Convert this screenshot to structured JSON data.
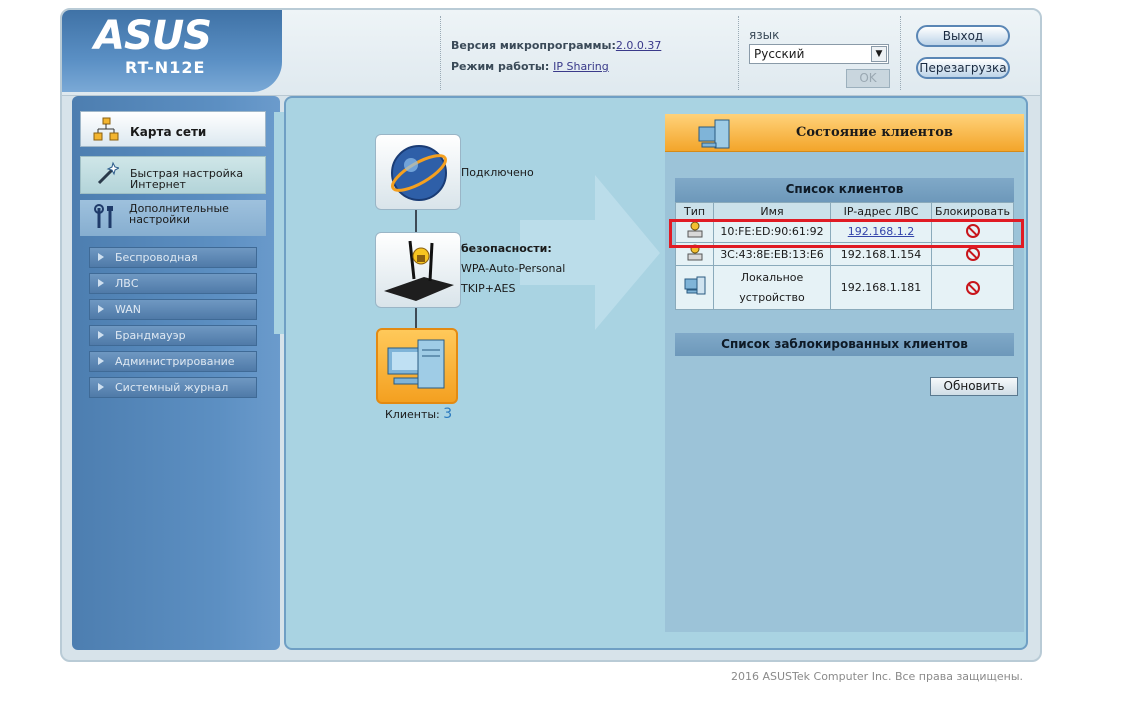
{
  "header": {
    "brand": "ASUS",
    "model": "RT-N12E",
    "firmware_label": "Версия микропрограммы:",
    "firmware_version": "2.0.0.37",
    "mode_label": "Режим работы:",
    "mode_value": "IP Sharing",
    "language_label": "язык",
    "language_selected": "Русский",
    "ok_label": "OK",
    "logout_label": "Выход",
    "reboot_label": "Перезагрузка"
  },
  "menu": {
    "network_map": "Карта сети",
    "quick_setup_line1": "Быстрая настройка",
    "quick_setup_line2": "Интернет",
    "advanced_line1": "Дополнительные",
    "advanced_line2": "настройки",
    "items": [
      {
        "label": "Беспроводная"
      },
      {
        "label": "ЛВС"
      },
      {
        "label": "WAN"
      },
      {
        "label": "Брандмауэр"
      },
      {
        "label": "Администрирование"
      },
      {
        "label": "Системный журнал"
      }
    ]
  },
  "map": {
    "internet_status": "Подключено",
    "security_label": "безопасности:",
    "security_mode": "WPA-Auto-Personal",
    "security_cipher": "TKIP+AES",
    "clients_label": "Клиенты:",
    "clients_count": "3"
  },
  "panel": {
    "title": "Состояние клиентов",
    "client_list_title": "Список клиентов",
    "columns": [
      "Тип",
      "Имя",
      "IP-адрес ЛВС",
      "Блокировать"
    ],
    "rows": [
      {
        "name": "10:FE:ED:90:61:92",
        "ip": "192.168.1.2"
      },
      {
        "name": "3C:43:8E:EB:13:E6",
        "ip": "192.168.1.154"
      },
      {
        "name_line1": "Локальное",
        "name_line2": "устройство",
        "ip": "192.168.1.181"
      }
    ],
    "blocked_title": "Список заблокированных клиентов",
    "refresh_label": "Обновить"
  },
  "footer": {
    "copyright": "2016 ASUSTek Computer Inc. Все права защищены."
  }
}
